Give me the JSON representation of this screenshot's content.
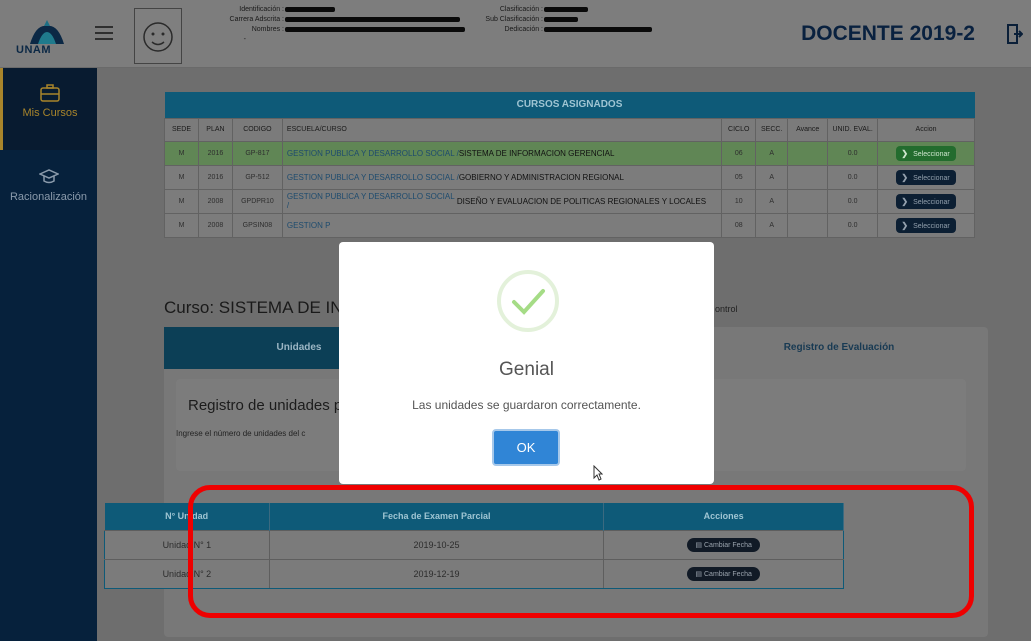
{
  "header": {
    "logo_text": "UNAM",
    "title": "DOCENTE 2019-2",
    "info_left": [
      "Identificación :",
      "Carrera Adscrita :",
      "Nombres :"
    ],
    "info_right": [
      "Clasificación :",
      "Sub Clasificación :",
      "Dedicación :"
    ],
    "extra_mark": "-"
  },
  "sidebar": {
    "items": [
      {
        "label": "Mis Cursos",
        "icon": "briefcase-icon"
      },
      {
        "label": "Racionalización",
        "icon": "graduation-cap-icon"
      }
    ]
  },
  "courses": {
    "caption": "CURSOS ASIGNADOS",
    "headers": [
      "SEDE",
      "PLAN",
      "CODIGO",
      "ESCUELA/CURSO",
      "CICLO",
      "SECC.",
      "Avance",
      "UNID. EVAL.",
      "Accion"
    ],
    "rows": [
      {
        "sede": "M",
        "plan": "2016",
        "codigo": "GP-817",
        "escuela": "GESTION PUBLICA Y DESARROLLO SOCIAL /",
        "curso": "SISTEMA DE INFORMACION GERENCIAL",
        "ciclo": "06",
        "secc": "A",
        "avance": "",
        "unid": "0.0",
        "accion": "Seleccionar"
      },
      {
        "sede": "M",
        "plan": "2016",
        "codigo": "GP-512",
        "escuela": "GESTION PUBLICA Y DESARROLLO SOCIAL /",
        "curso": "GOBIERNO Y ADMINISTRACION REGIONAL",
        "ciclo": "05",
        "secc": "A",
        "avance": "",
        "unid": "0.0",
        "accion": "Seleccionar"
      },
      {
        "sede": "M",
        "plan": "2008",
        "codigo": "GPDPR10",
        "escuela": "GESTION PUBLICA Y DESARROLLO SOCIAL /",
        "curso": "DISEÑO Y EVALUACION DE POLITICAS REGIONALES Y LOCALES",
        "ciclo": "10",
        "secc": "A",
        "avance": "",
        "unid": "0.0",
        "accion": "Seleccionar"
      },
      {
        "sede": "M",
        "plan": "2008",
        "codigo": "GPSIN08",
        "escuela": "GESTION P",
        "curso": "",
        "ciclo": "08",
        "secc": "A",
        "avance": "",
        "unid": "0.0",
        "accion": "Seleccionar"
      }
    ]
  },
  "course_title": "Curso: SISTEMA DE IN",
  "control_text": "ontrol",
  "tabs": [
    "Unidades",
    "Registro de Evaluación"
  ],
  "registro": {
    "title": "Registro de unidades por",
    "subtitle": "Ingrese el número de unidades del c"
  },
  "units": {
    "headers": [
      "N° Unidad",
      "Fecha de Examen Parcial",
      "Acciones"
    ],
    "rows": [
      {
        "unidad": "Unidad N° 1",
        "fecha": "2019-10-25",
        "accion": "Cambiar Fecha"
      },
      {
        "unidad": "Unidad N° 2",
        "fecha": "2019-12-19",
        "accion": "Cambiar Fecha"
      }
    ]
  },
  "modal": {
    "title": "Genial",
    "text": "Las unidades se guardaron correctamente.",
    "ok": "OK"
  },
  "colors": {
    "accent": "#0e5a78",
    "highlight": "#ef0000",
    "ok_button": "#3085d6",
    "success": "#a5dc86"
  }
}
